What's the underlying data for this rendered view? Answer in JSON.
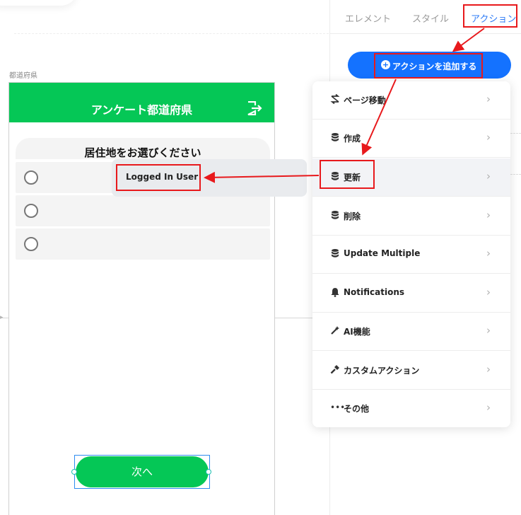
{
  "canvas": {
    "frame_label": "都道府県"
  },
  "phone": {
    "header_title": "アンケート都道府県",
    "question": "居住地をお選びください",
    "options_count": 3,
    "next_label": "次へ"
  },
  "popover": {
    "text": "Logged In User"
  },
  "panel": {
    "tabs": [
      {
        "label": "エレメント"
      },
      {
        "label": "スタイル"
      },
      {
        "label": "アクション"
      }
    ],
    "active_tab": "アクション",
    "add_action_label": "アクションを追加する",
    "menu": [
      {
        "label": "ページ移動",
        "icon": "page-transition-icon"
      },
      {
        "label": "作成",
        "icon": "database-icon"
      },
      {
        "label": "更新",
        "icon": "database-icon"
      },
      {
        "label": "削除",
        "icon": "database-icon"
      },
      {
        "label": "Update Multiple",
        "icon": "database-icon"
      },
      {
        "label": "Notifications",
        "icon": "bell-icon"
      },
      {
        "label": "AI機能",
        "icon": "magic-wand-icon"
      },
      {
        "label": "カスタムアクション",
        "icon": "hammer-icon"
      },
      {
        "label": "その他",
        "icon": "more-dots-icon"
      }
    ],
    "highlighted_item": "更新"
  },
  "colors": {
    "brand_green": "#05c756",
    "accent_blue": "#1472ff",
    "annotation_red": "#e8191c"
  }
}
